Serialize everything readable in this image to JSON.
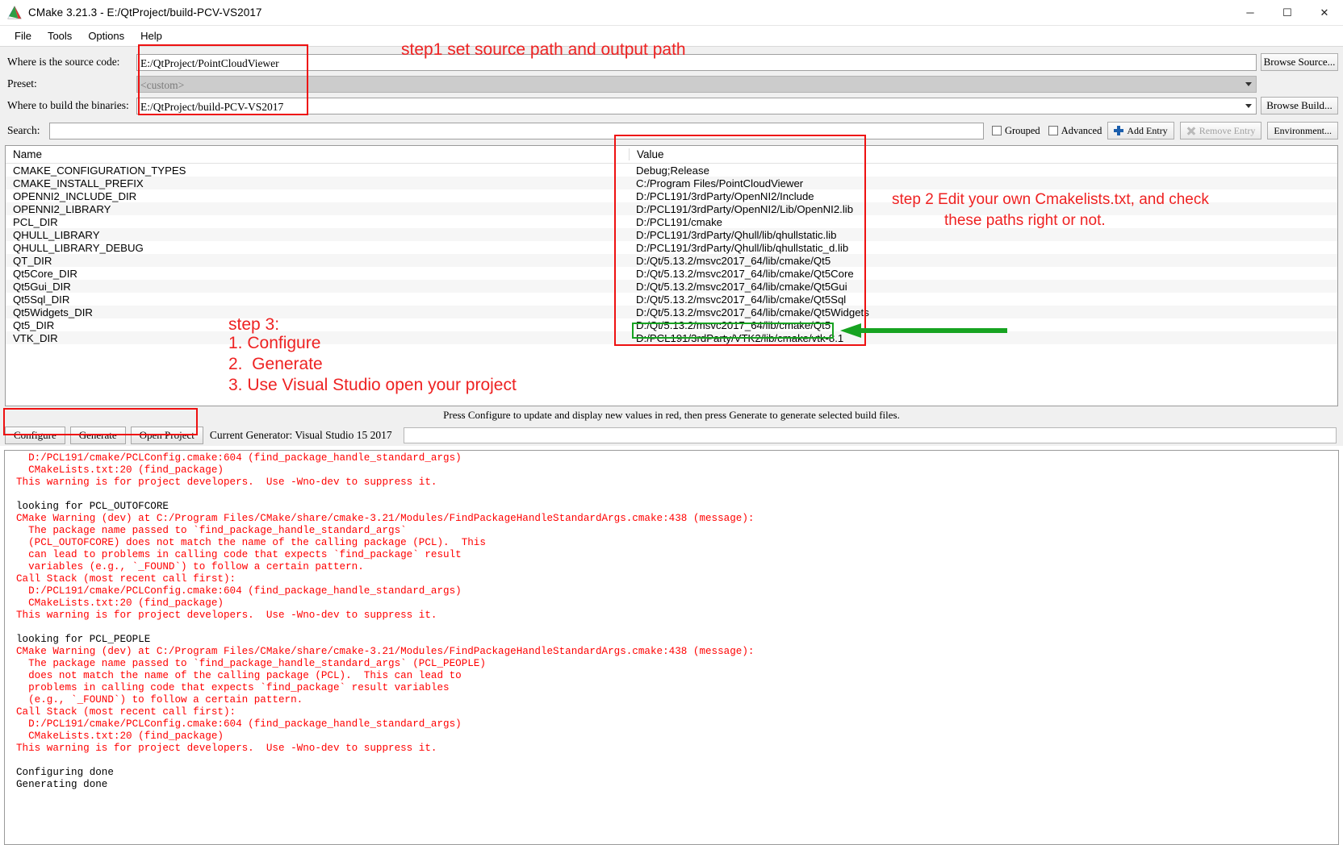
{
  "window": {
    "title": "CMake 3.21.3 - E:/QtProject/build-PCV-VS2017",
    "minimize": "─",
    "maximize": "☐",
    "close": "✕"
  },
  "menubar": [
    "File",
    "Tools",
    "Options",
    "Help"
  ],
  "fields": {
    "source_label": "Where is the source code:",
    "source_value": "E:/QtProject/PointCloudViewer",
    "browse_source": "Browse Source...",
    "preset_label": "Preset:",
    "preset_value": "<custom>",
    "build_label": "Where to build the binaries:",
    "build_value": "E:/QtProject/build-PCV-VS2017",
    "browse_build": "Browse Build..."
  },
  "search": {
    "label": "Search:",
    "value": "",
    "grouped": "Grouped",
    "advanced": "Advanced",
    "add_entry": "Add Entry",
    "remove_entry": "Remove Entry",
    "environment": "Environment..."
  },
  "cache": {
    "headers": [
      "Name",
      "Value"
    ],
    "rows": [
      {
        "name": "CMAKE_CONFIGURATION_TYPES",
        "value": "Debug;Release"
      },
      {
        "name": "CMAKE_INSTALL_PREFIX",
        "value": "C:/Program Files/PointCloudViewer"
      },
      {
        "name": "OPENNI2_INCLUDE_DIR",
        "value": "D:/PCL191/3rdParty/OpenNI2/Include"
      },
      {
        "name": "OPENNI2_LIBRARY",
        "value": "D:/PCL191/3rdParty/OpenNI2/Lib/OpenNI2.lib"
      },
      {
        "name": "PCL_DIR",
        "value": "D:/PCL191/cmake"
      },
      {
        "name": "QHULL_LIBRARY",
        "value": "D:/PCL191/3rdParty/Qhull/lib/qhullstatic.lib"
      },
      {
        "name": "QHULL_LIBRARY_DEBUG",
        "value": "D:/PCL191/3rdParty/Qhull/lib/qhullstatic_d.lib"
      },
      {
        "name": "QT_DIR",
        "value": "D:/Qt/5.13.2/msvc2017_64/lib/cmake/Qt5"
      },
      {
        "name": "Qt5Core_DIR",
        "value": "D:/Qt/5.13.2/msvc2017_64/lib/cmake/Qt5Core"
      },
      {
        "name": "Qt5Gui_DIR",
        "value": "D:/Qt/5.13.2/msvc2017_64/lib/cmake/Qt5Gui"
      },
      {
        "name": "Qt5Sql_DIR",
        "value": "D:/Qt/5.13.2/msvc2017_64/lib/cmake/Qt5Sql"
      },
      {
        "name": "Qt5Widgets_DIR",
        "value": "D:/Qt/5.13.2/msvc2017_64/lib/cmake/Qt5Widgets"
      },
      {
        "name": "Qt5_DIR",
        "value": "D:/Qt/5.13.2/msvc2017_64/lib/cmake/Qt5"
      },
      {
        "name": "VTK_DIR",
        "value": "D:/PCL191/3rdParty/VTK2/lib/cmake/vtk-8.1"
      }
    ]
  },
  "hint": "Press Configure to update and display new values in red, then press Generate to generate selected build files.",
  "actions": {
    "configure": "Configure",
    "generate": "Generate",
    "open_project": "Open Project",
    "generator_text": "Current Generator: Visual Studio 15 2017"
  },
  "log": {
    "lines": [
      {
        "t": "  D:/PCL191/cmake/PCLConfig.cmake:604 (find_package_handle_standard_args)",
        "c": "red"
      },
      {
        "t": "  CMakeLists.txt:20 (find_package)",
        "c": "red"
      },
      {
        "t": "This warning is for project developers.  Use -Wno-dev to suppress it.",
        "c": "red"
      },
      {
        "t": "",
        "c": "blk"
      },
      {
        "t": "looking for PCL_OUTOFCORE",
        "c": "blk"
      },
      {
        "t": "CMake Warning (dev) at C:/Program Files/CMake/share/cmake-3.21/Modules/FindPackageHandleStandardArgs.cmake:438 (message):",
        "c": "red"
      },
      {
        "t": "  The package name passed to `find_package_handle_standard_args`",
        "c": "red"
      },
      {
        "t": "  (PCL_OUTOFCORE) does not match the name of the calling package (PCL).  This",
        "c": "red"
      },
      {
        "t": "  can lead to problems in calling code that expects `find_package` result",
        "c": "red"
      },
      {
        "t": "  variables (e.g., `_FOUND`) to follow a certain pattern.",
        "c": "red"
      },
      {
        "t": "Call Stack (most recent call first):",
        "c": "red"
      },
      {
        "t": "  D:/PCL191/cmake/PCLConfig.cmake:604 (find_package_handle_standard_args)",
        "c": "red"
      },
      {
        "t": "  CMakeLists.txt:20 (find_package)",
        "c": "red"
      },
      {
        "t": "This warning is for project developers.  Use -Wno-dev to suppress it.",
        "c": "red"
      },
      {
        "t": "",
        "c": "blk"
      },
      {
        "t": "looking for PCL_PEOPLE",
        "c": "blk"
      },
      {
        "t": "CMake Warning (dev) at C:/Program Files/CMake/share/cmake-3.21/Modules/FindPackageHandleStandardArgs.cmake:438 (message):",
        "c": "red"
      },
      {
        "t": "  The package name passed to `find_package_handle_standard_args` (PCL_PEOPLE)",
        "c": "red"
      },
      {
        "t": "  does not match the name of the calling package (PCL).  This can lead to",
        "c": "red"
      },
      {
        "t": "  problems in calling code that expects `find_package` result variables",
        "c": "red"
      },
      {
        "t": "  (e.g., `_FOUND`) to follow a certain pattern.",
        "c": "red"
      },
      {
        "t": "Call Stack (most recent call first):",
        "c": "red"
      },
      {
        "t": "  D:/PCL191/cmake/PCLConfig.cmake:604 (find_package_handle_standard_args)",
        "c": "red"
      },
      {
        "t": "  CMakeLists.txt:20 (find_package)",
        "c": "red"
      },
      {
        "t": "This warning is for project developers.  Use -Wno-dev to suppress it.",
        "c": "red"
      },
      {
        "t": "",
        "c": "blk"
      },
      {
        "t": "Configuring done",
        "c": "blk"
      },
      {
        "t": "Generating done",
        "c": "blk"
      }
    ]
  },
  "annotations": {
    "step1": "step1 set source path and output path",
    "step2_line1": "step 2 Edit your own Cmakelists.txt, and check",
    "step2_line2": "these paths right or not.",
    "step3_title": "step 3:",
    "step3_l1": "1. Configure",
    "step3_l2": "2.  Generate",
    "step3_l3": "3. Use Visual Studio open your project",
    "red": "#ee2222",
    "green": "#17a321"
  }
}
